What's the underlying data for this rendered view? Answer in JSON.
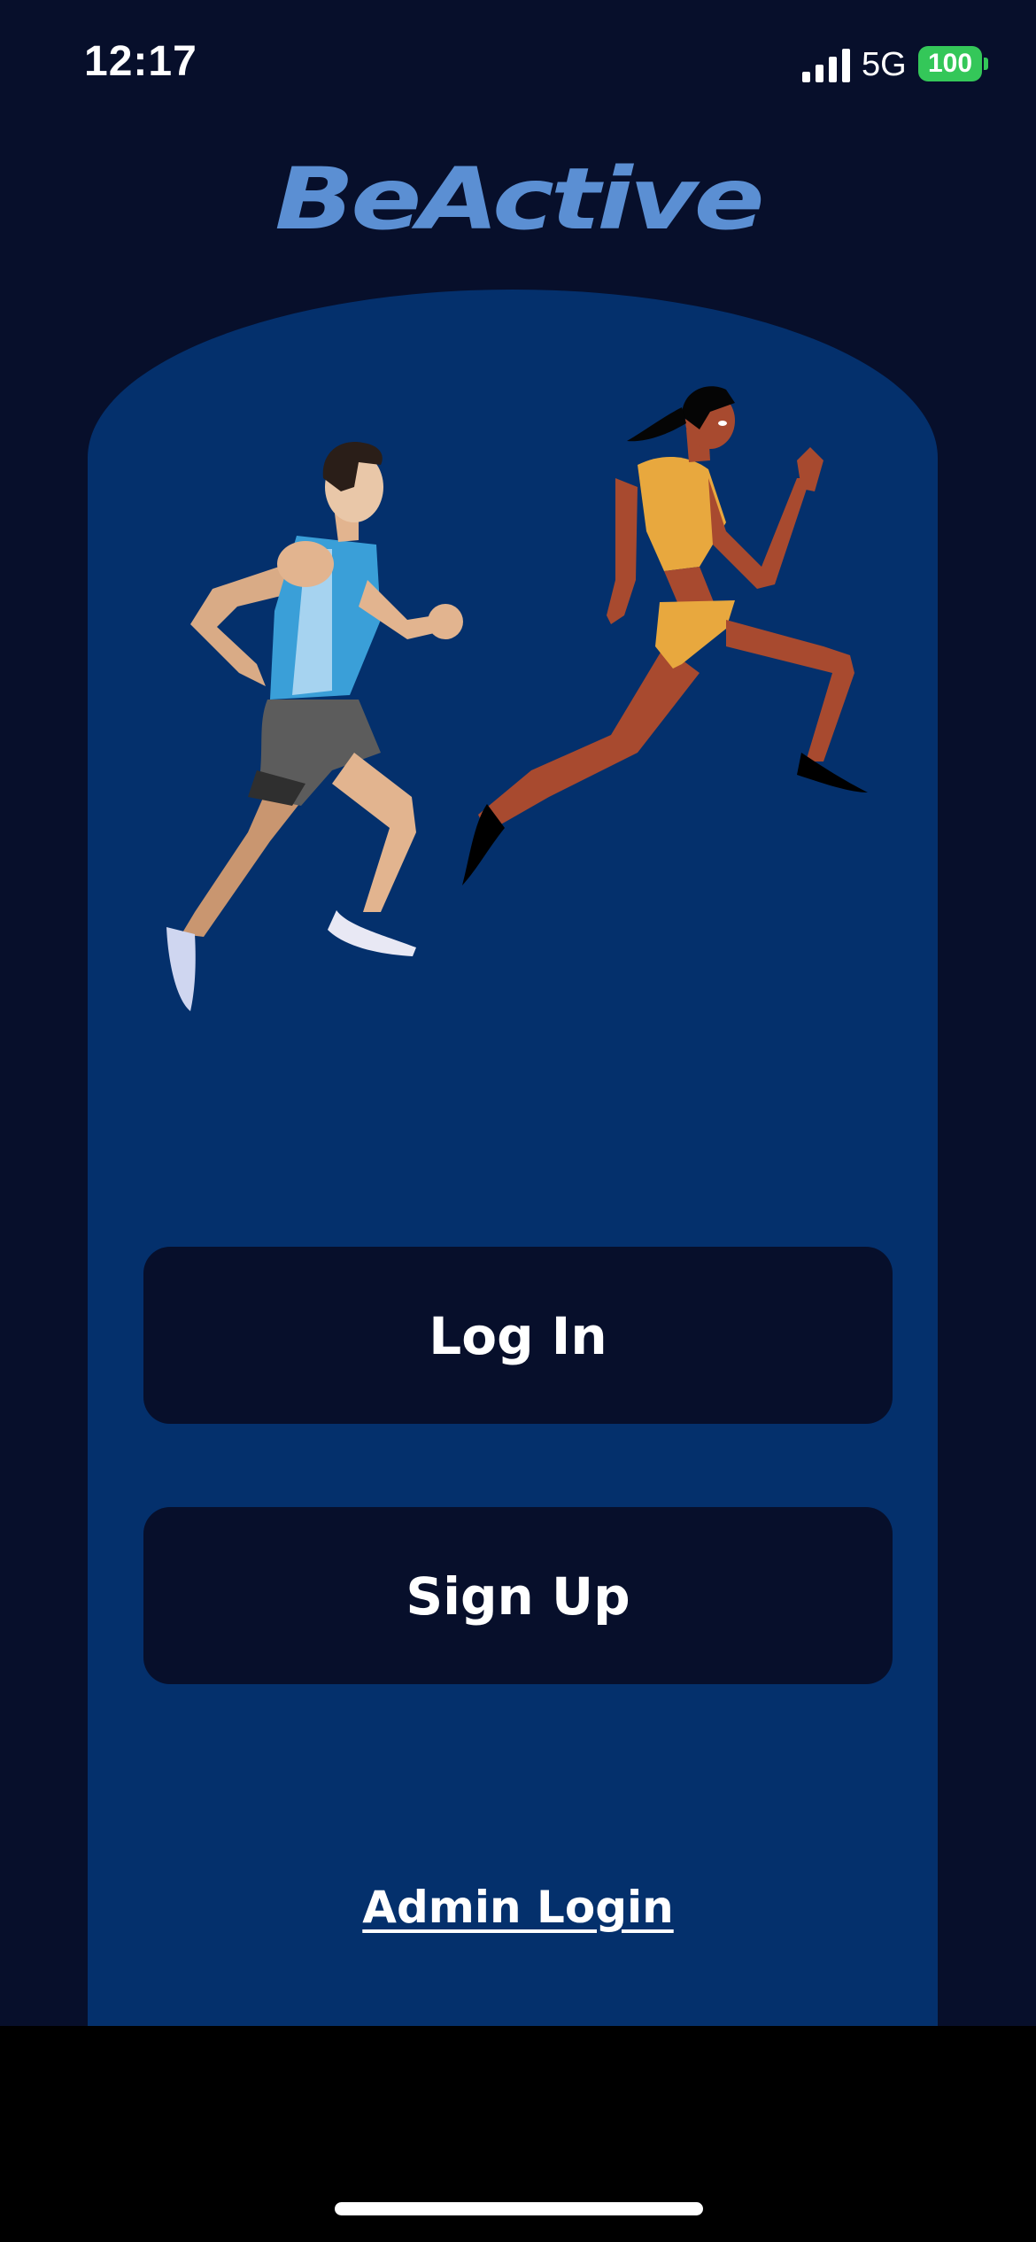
{
  "status_bar": {
    "time": "12:17",
    "network": "5G",
    "battery": "100",
    "signal_icon": "cellular-signal-icon",
    "battery_icon": "battery-icon",
    "battery_color": "#34c759"
  },
  "brand": {
    "logo_text": "BeActive",
    "logo_color": "#5b8fd3"
  },
  "hero": {
    "illustration": "runners-illustration"
  },
  "actions": {
    "login_label": "Log In",
    "signup_label": "Sign Up",
    "admin_label": "Admin Login"
  },
  "theme": {
    "background": "#070f2b",
    "panel": "#04306c",
    "button": "#070f2b"
  }
}
